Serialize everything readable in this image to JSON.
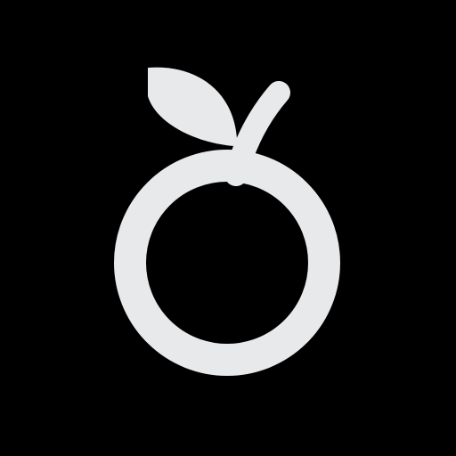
{
  "icon": {
    "name": "fruit-icon",
    "foreground_color": "#E8E9EB",
    "background_color": "#000000"
  }
}
